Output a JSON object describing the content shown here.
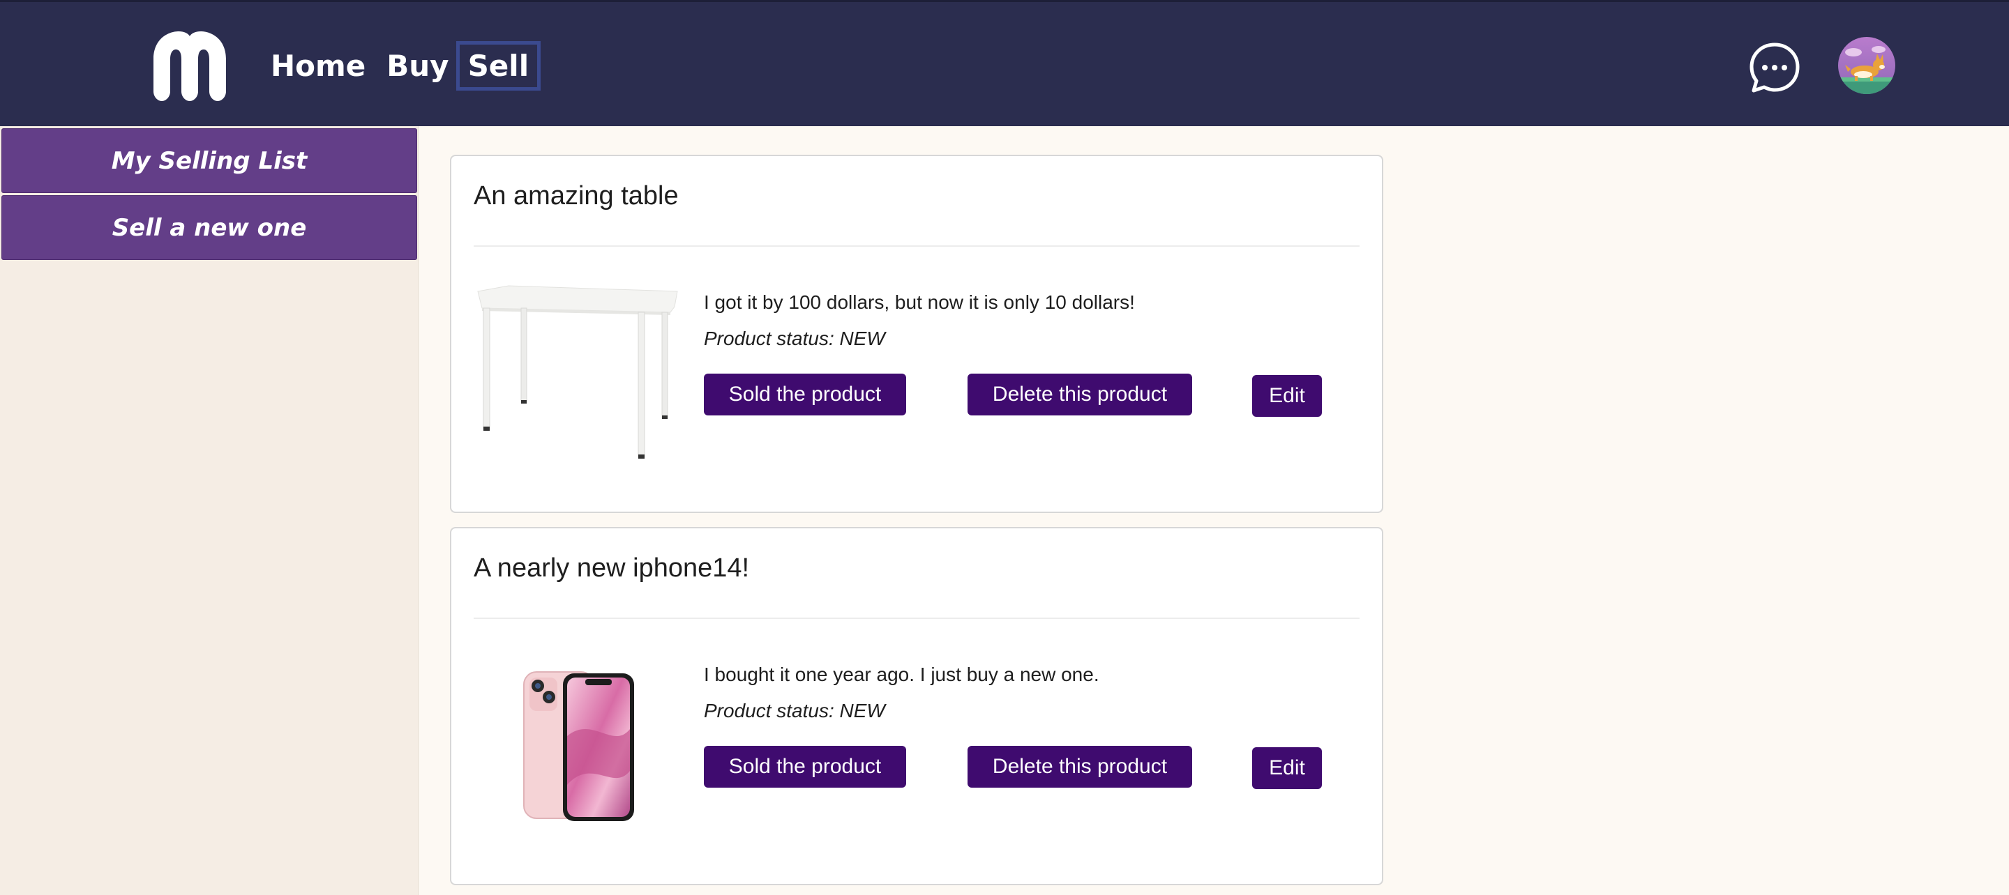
{
  "header": {
    "nav": {
      "home": "Home",
      "buy": "Buy",
      "sell": "Sell"
    },
    "colors": {
      "background": "#2b2d4f",
      "selected_border": "#3b4a8f"
    },
    "icons": {
      "logo": "m-logo-icon",
      "chat": "chat-bubble-icon",
      "avatar": "corgi-avatar"
    }
  },
  "sidebar": {
    "items": [
      {
        "label": "My Selling List"
      },
      {
        "label": "Sell a new one"
      }
    ],
    "color": "#633e88"
  },
  "products": [
    {
      "title": "An amazing table",
      "description": "I got it by 100 dollars, but now it is only 10 dollars!",
      "status": "Product status: NEW",
      "image": "white-table-image",
      "buttons": {
        "sold": "Sold the product",
        "delete": "Delete this product",
        "edit": "Edit"
      }
    },
    {
      "title": "A nearly new iphone14!",
      "description": "I bought it one year ago. I just buy a new one.",
      "status": "Product status: NEW",
      "image": "pink-iphone-image",
      "buttons": {
        "sold": "Sold the product",
        "delete": "Delete this product",
        "edit": "Edit"
      }
    }
  ],
  "button_color": "#3f0b6f"
}
